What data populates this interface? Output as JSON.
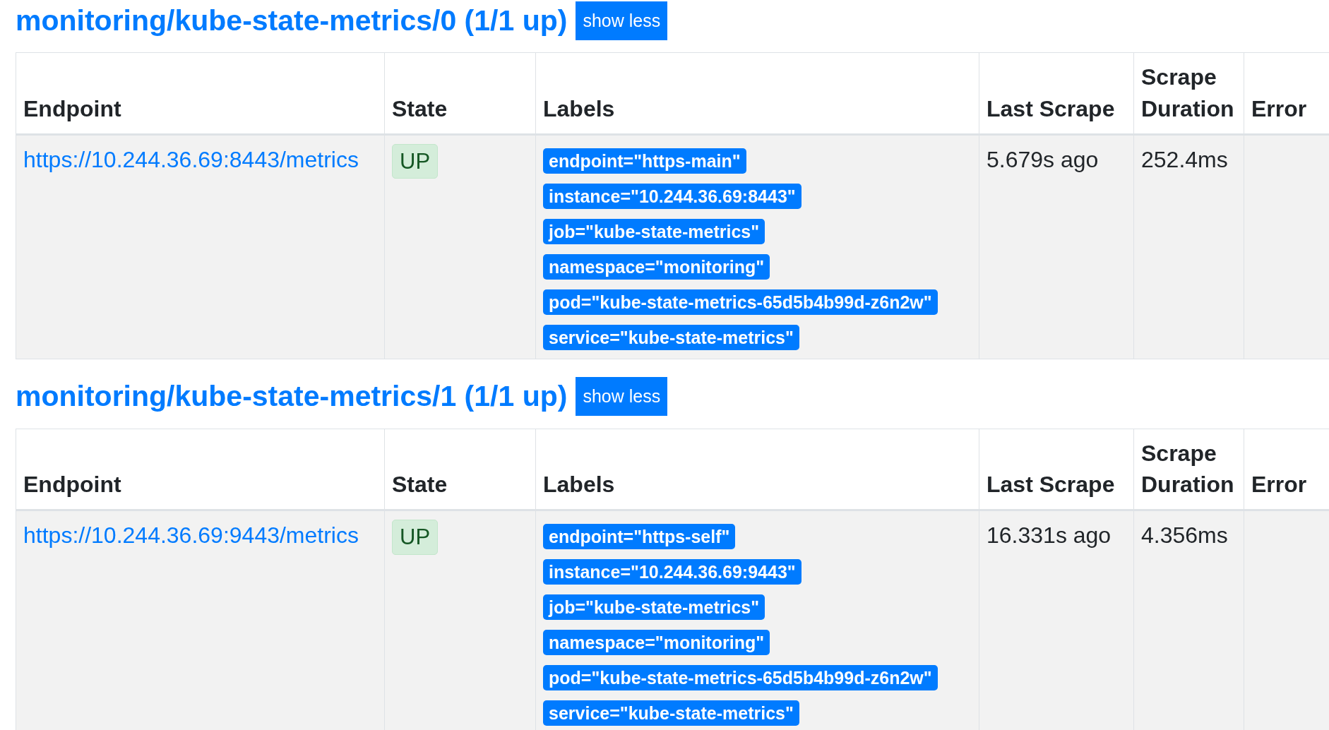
{
  "jobs": [
    {
      "title": "monitoring/kube-state-metrics/0 (1/1 up)",
      "toggle": "show less",
      "columns": [
        "Endpoint",
        "State",
        "Labels",
        "Last Scrape",
        "Scrape Duration",
        "Error"
      ],
      "rows": [
        {
          "endpoint": "https://10.244.36.69:8443/metrics",
          "state": "UP",
          "kind": "up",
          "labels": [
            "endpoint=\"https-main\"",
            "instance=\"10.244.36.69:8443\"",
            "job=\"kube-state-metrics\"",
            "namespace=\"monitoring\"",
            "pod=\"kube-state-metrics-65d5b4b99d-z6n2w\"",
            "service=\"kube-state-metrics\""
          ],
          "last_scrape": "5.679s ago",
          "scrape_duration": "252.4ms"
        }
      ]
    },
    {
      "title": "monitoring/kube-state-metrics/1 (1/1 up)",
      "toggle": "show less",
      "columns": [
        "Endpoint",
        "State",
        "Labels",
        "Last Scrape",
        "Scrape Duration",
        "Error"
      ],
      "rows": [
        {
          "endpoint": "https://10.244.36.69:9443/metrics",
          "state": "UP",
          "kind": "up",
          "labels": [
            "endpoint=\"https-self\"",
            "instance=\"10.244.36.69:9443\"",
            "job=\"kube-state-metrics\"",
            "namespace=\"monitoring\"",
            "pod=\"kube-state-metrics-65d5b4b99d-z6n2w\"",
            "service=\"kube-state-metrics\""
          ],
          "last_scrape": "16.331s ago",
          "scrape_duration": "4.356ms"
        }
      ]
    }
  ]
}
